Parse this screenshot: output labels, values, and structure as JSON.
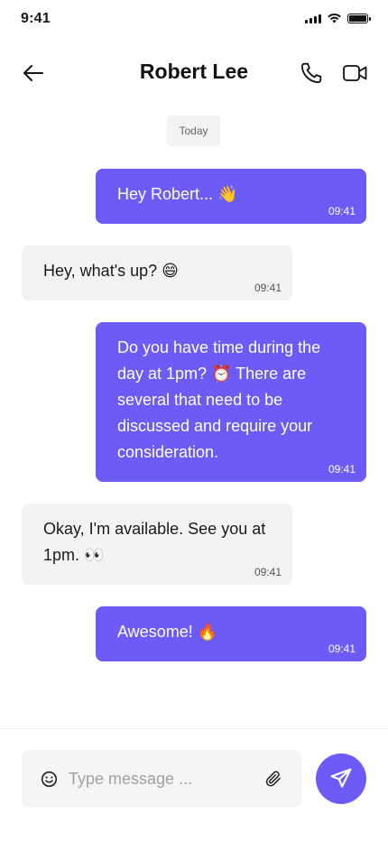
{
  "status_bar": {
    "time": "9:41"
  },
  "header": {
    "title": "Robert Lee"
  },
  "date_chip": "Today",
  "messages": [
    {
      "direction": "sent",
      "text": "Hey Robert... 👋",
      "time": "09:41"
    },
    {
      "direction": "received",
      "text": "Hey, what's up? 😄",
      "time": "09:41"
    },
    {
      "direction": "sent",
      "text": "Do you have time during the day at 1pm? ⏰ There are several that need to be discussed and require your consideration.",
      "time": "09:41"
    },
    {
      "direction": "received",
      "text": "Okay, I'm available. See you at 1pm. 👀",
      "time": "09:41"
    },
    {
      "direction": "sent",
      "text": "Awesome! 🔥",
      "time": "09:41"
    }
  ],
  "composer": {
    "placeholder": "Type message ...",
    "value": ""
  },
  "icons": {
    "back": "arrow-left-icon",
    "call": "phone-icon",
    "video": "video-camera-icon",
    "emoji": "smiley-icon",
    "attach": "paperclip-icon",
    "send": "paper-plane-icon"
  },
  "colors": {
    "accent": "#6c5cf7",
    "received_bubble": "#f3f3f3",
    "date_chip": "#f3f3f3",
    "composer_bg": "#f5f5f5"
  }
}
